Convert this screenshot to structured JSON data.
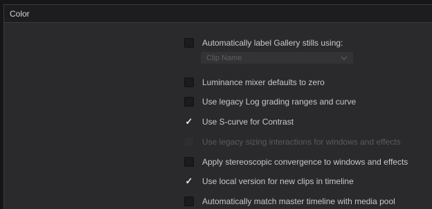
{
  "panel": {
    "title": "Color"
  },
  "options": [
    {
      "label": "Automatically label Gallery stills using:",
      "checked": false,
      "enabled": true
    },
    {
      "label": "Luminance mixer defaults to zero",
      "checked": false,
      "enabled": true
    },
    {
      "label": "Use legacy Log grading ranges and curve",
      "checked": false,
      "enabled": true
    },
    {
      "label": "Use S-curve for Contrast",
      "checked": true,
      "enabled": true
    },
    {
      "label": "Use legacy sizing interactions for windows and effects",
      "checked": false,
      "enabled": false
    },
    {
      "label": "Apply stereoscopic convergence to windows and effects",
      "checked": false,
      "enabled": true
    },
    {
      "label": "Use local version for new clips in timeline",
      "checked": true,
      "enabled": true
    },
    {
      "label": "Automatically match master timeline with media pool",
      "checked": false,
      "enabled": true
    }
  ],
  "gallery_label_select": {
    "value": "Clip Name",
    "enabled": false
  },
  "check_glyph": "✓"
}
